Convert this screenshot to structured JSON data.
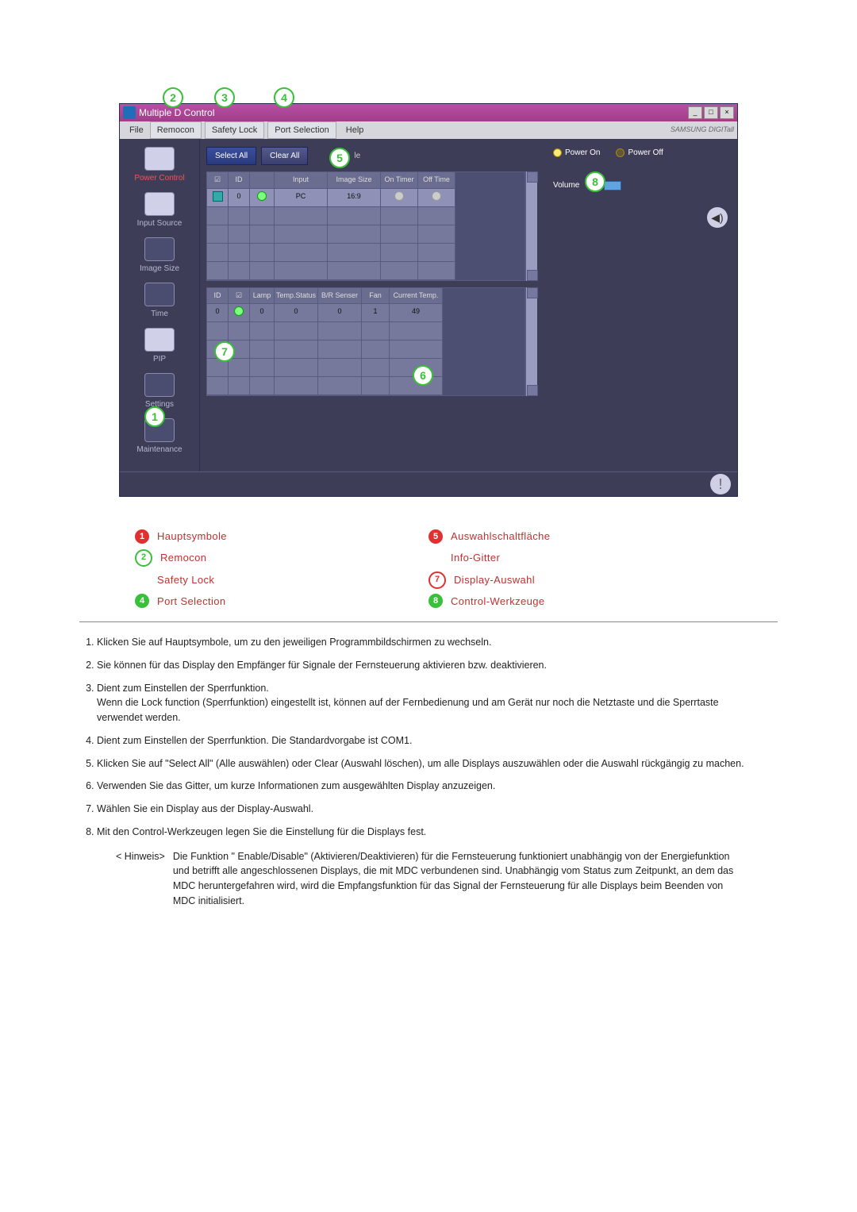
{
  "window": {
    "title": "Multiple D       Control",
    "min": "_",
    "max": "□",
    "close": "×"
  },
  "menubar": {
    "file": "File",
    "remocon": "Remocon",
    "safety": "Safety Lock",
    "port": "Port Selection",
    "help": "Help",
    "brand": "SAMSUNG DIGITall"
  },
  "sidebar": [
    {
      "label": "Power Control",
      "kind": "power"
    },
    {
      "label": "Input Source",
      "kind": "input"
    },
    {
      "label": "Image Size",
      "kind": "img"
    },
    {
      "label": "Time",
      "kind": "time"
    },
    {
      "label": "PIP",
      "kind": "pip"
    },
    {
      "label": "Settings",
      "kind": "set"
    },
    {
      "label": "Maintenance",
      "kind": "maint"
    }
  ],
  "buttons": {
    "select_all": "Select All",
    "clear_all": "Clear All",
    "le": "le"
  },
  "grid1": {
    "headers": {
      "chk": "☑",
      "id": "ID",
      "lamp": "",
      "input": "Input",
      "isize": "Image Size",
      "on": "On Timer",
      "off": "Off Time"
    },
    "row": {
      "id": "0",
      "input": "PC",
      "isize": "16:9"
    }
  },
  "grid2": {
    "headers": {
      "id": "ID",
      "chk": "☑",
      "lamp": "Lamp",
      "temp": "Temp.Status",
      "br": "B/R Senser",
      "fan": "Fan",
      "cur": "Current Temp."
    },
    "row": {
      "id": "0",
      "lamp": "0",
      "temp": "0",
      "br": "0",
      "fan": "1",
      "cur": "49"
    }
  },
  "right": {
    "on": "Power On",
    "off": "Power Off",
    "vol_label": "Volume",
    "vol_val": "10"
  },
  "callouts": {
    "c1": "1",
    "c2": "2",
    "c3": "3",
    "c4": "4",
    "c5": "5",
    "c6": "6",
    "c7": "7",
    "c8": "8"
  },
  "legend": [
    {
      "n": "1",
      "label": "Hauptsymbole",
      "style": "red"
    },
    {
      "n": "2",
      "label": "Remocon",
      "style": "outline-g"
    },
    {
      "n": "3",
      "label": "Safety Lock",
      "style": "blank"
    },
    {
      "n": "4",
      "label": "Port Selection",
      "style": "green"
    },
    {
      "n": "5",
      "label": "Auswahlschaltfläche",
      "style": "red"
    },
    {
      "n": "6",
      "label": "Info-Gitter",
      "style": "blank"
    },
    {
      "n": "7",
      "label": "Display-Auswahl",
      "style": "outline"
    },
    {
      "n": "8",
      "label": "Control-Werkzeuge",
      "style": "green"
    }
  ],
  "notes": [
    "Klicken Sie auf Hauptsymbole, um zu den jeweiligen Programmbildschirmen zu wechseln.",
    "Sie können für das Display den Empfänger für Signale der Fernsteuerung aktivieren bzw. deaktivieren.",
    "Dient zum Einstellen der Sperrfunktion.\nWenn die Lock function (Sperrfunktion) eingestellt ist, können auf der Fernbedienung und am Gerät nur noch die Netztaste und die Sperrtaste verwendet werden.",
    "Dient zum Einstellen der Sperrfunktion. Die Standardvorgabe ist COM1.",
    "Klicken Sie auf \"Select All\" (Alle auswählen) oder Clear (Auswahl löschen), um alle Displays auszuwählen oder die Auswahl rückgängig zu machen.",
    "Verwenden Sie das Gitter, um kurze Informationen zum ausgewählten Display anzuzeigen.",
    "Wählen Sie ein Display aus der Display-Auswahl.",
    "Mit den Control-Werkzeugen legen Sie die Einstellung für die Displays fest."
  ],
  "hinweis": {
    "label": "< Hinweis>",
    "text": "Die Funktion \" Enable/Disable\" (Aktivieren/Deaktivieren) für die Fernsteuerung funktioniert unabhängig von der Energiefunktion und betrifft alle angeschlossenen Displays, die mit MDC verbundenen sind. Unabhängig vom Status zum Zeitpunkt, an dem das MDC heruntergefahren wird, wird die Empfangsfunktion für das Signal der Fernsteuerung für alle Displays beim Beenden von MDC initialisiert."
  }
}
